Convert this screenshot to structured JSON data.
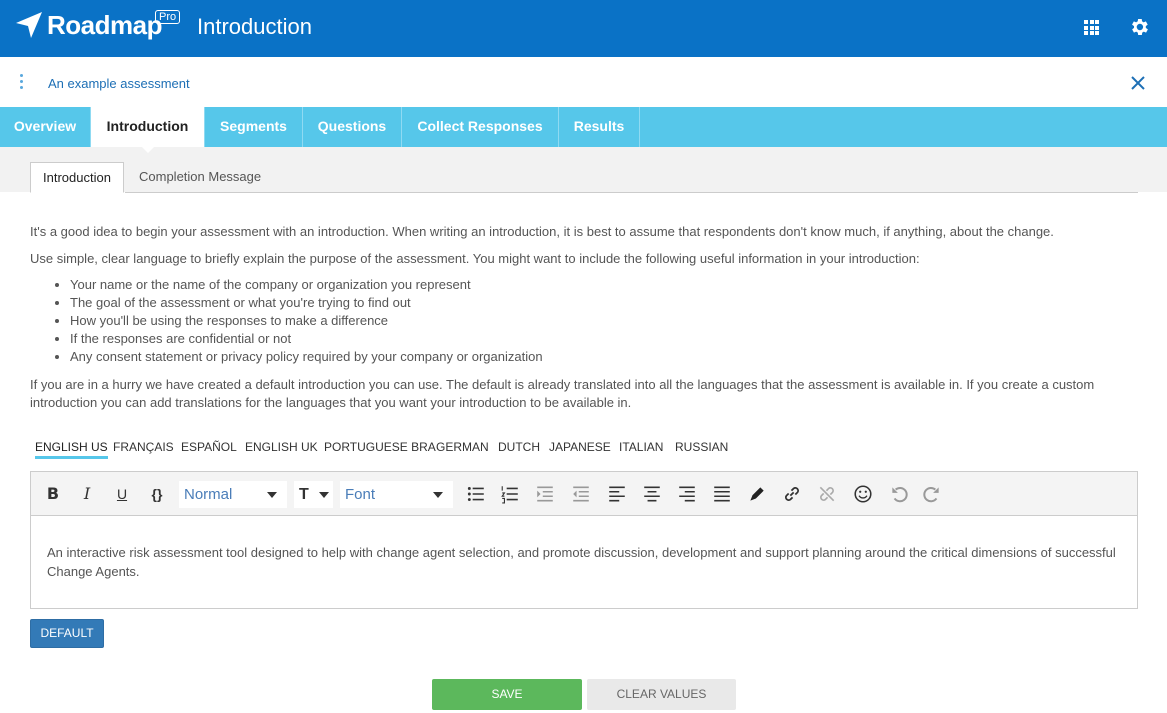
{
  "header": {
    "logo_text": "Roadmap",
    "pro_badge": "Pro",
    "title": "Introduction",
    "icons": [
      "apps-grid-icon",
      "gear-icon"
    ]
  },
  "subbar": {
    "assessment_name": "An example assessment"
  },
  "main_tabs": [
    {
      "label": "Overview",
      "active": false
    },
    {
      "label": "Introduction",
      "active": true
    },
    {
      "label": "Segments",
      "active": false
    },
    {
      "label": "Questions",
      "active": false
    },
    {
      "label": "Collect Responses",
      "active": false
    },
    {
      "label": "Results",
      "active": false
    }
  ],
  "sub_tabs": [
    {
      "label": "Introduction",
      "active": true
    },
    {
      "label": "Completion Message",
      "active": false
    }
  ],
  "intro": {
    "p1": "It's a good idea to begin your assessment with an introduction. When writing an introduction, it is best to assume that respondents don't know much, if anything, about the change.",
    "p2": "Use simple, clear language to briefly explain the purpose of the assessment. You might want to include the following useful information in your introduction:",
    "bullets": [
      "Your name or the name of the company or organization you represent",
      "The goal of the assessment or what you're trying to find out",
      "How you'll be using the responses to make a difference",
      "If the responses are confidential or not",
      "Any consent statement or privacy policy required by your company or organization"
    ],
    "p3": "If you are in a hurry we have created a default introduction you can use. The default is already translated into all the languages that the assessment is available in. If you create a custom introduction you can add translations for the languages that you want your introduction to be available in."
  },
  "languages": [
    {
      "label": "ENGLISH US",
      "active": true
    },
    {
      "label": "FRANÇAIS",
      "active": false
    },
    {
      "label": "ESPAÑOL",
      "active": false
    },
    {
      "label": "ENGLISH UK",
      "active": false
    },
    {
      "label": "PORTUGUESE BRA",
      "active": false
    },
    {
      "label": "GERMAN",
      "active": false
    },
    {
      "label": "DUTCH",
      "active": false
    },
    {
      "label": "JAPANESE",
      "active": false
    },
    {
      "label": "ITALIAN",
      "active": false
    },
    {
      "label": "RUSSIAN",
      "active": false
    }
  ],
  "editor": {
    "heading_select": "Normal",
    "font_select": "Font",
    "content": "An interactive risk assessment tool designed to help with change agent selection, and promote discussion, development and support planning around the critical dimensions of successful Change Agents."
  },
  "buttons": {
    "default": "DEFAULT",
    "save": "SAVE",
    "clear": "CLEAR VALUES"
  },
  "colors": {
    "header": "#0a72c6",
    "tab_bar": "#56c7ea",
    "save": "#5cb85c",
    "default": "#337ab7"
  }
}
